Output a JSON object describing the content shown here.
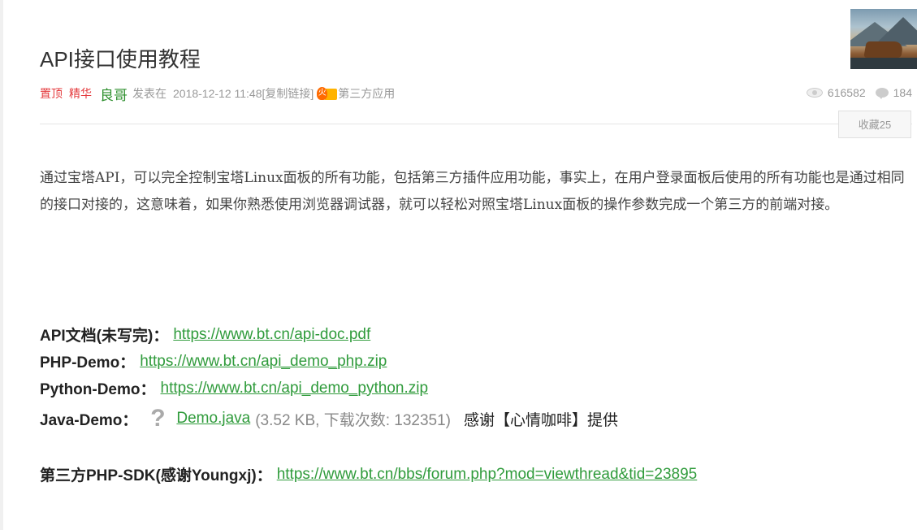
{
  "post": {
    "title": "API接口使用教程",
    "meta": {
      "tag_top": "置顶",
      "tag_digest": "精华",
      "author": "良哥",
      "posted_label": "发表在",
      "datetime": "2018-12-12 11:48",
      "copy_link": "[复制链接]",
      "hot_icon": "hot-flame-icon",
      "category": "第三方应用"
    },
    "stats": {
      "views": "616582",
      "replies": "184"
    },
    "favorite_button": "收藏25",
    "intro": "通过宝塔API，可以完全控制宝塔Linux面板的所有功能，包括第三方插件应用功能，事实上，在用户登录面板后使用的所有功能也是通过相同的接口对接的，这意味着，如果你熟悉使用浏览器调试器，就可以轻松对照宝塔Linux面板的操作参数完成一个第三方的前端对接。",
    "links": [
      {
        "label": "API文档(未写完)：",
        "url": "https://www.bt.cn/api-doc.pdf"
      },
      {
        "label": "PHP-Demo：",
        "url": "https://www.bt.cn/api_demo_php.zip"
      },
      {
        "label": "Python-Demo：",
        "url": "https://www.bt.cn/api_demo_python.zip"
      }
    ],
    "attachment": {
      "label": "Java-Demo：",
      "icon": "question-mark-icon",
      "file": "Demo.java",
      "info": "(3.52 KB, 下载次数: 132351)",
      "thanks": "感谢【心情咖啡】提供"
    },
    "sdk": {
      "label": "第三方PHP-SDK(感谢Youngxj)：",
      "url": "https://www.bt.cn/bbs/forum.php?mod=viewthread&tid=23895"
    }
  },
  "colors": {
    "link": "#2f9b3b",
    "tag": "#e4393c",
    "author": "#2d8f2d",
    "meta": "#999999"
  }
}
